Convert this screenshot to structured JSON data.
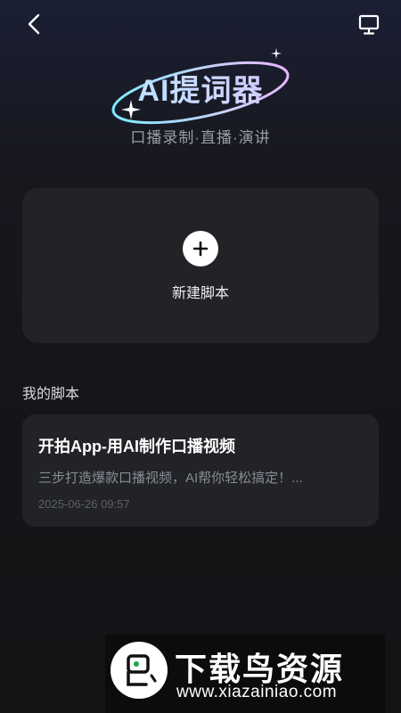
{
  "header": {
    "back_icon": "chevron-left-icon",
    "screen_icon": "monitor-icon"
  },
  "brand": {
    "title": "AI提词器",
    "subtitle": "口播录制·直播·演讲"
  },
  "new_script": {
    "icon": "plus-icon",
    "label": "新建脚本"
  },
  "my_scripts": {
    "section_title": "我的脚本",
    "items": [
      {
        "title": "开拍App-用AI制作口播视频",
        "description": "三步打造爆款口播视频，AI帮你轻松搞定！...",
        "date": "2025-06-26 09:57"
      }
    ]
  },
  "watermark": {
    "name": "下载鸟资源",
    "url": "www.xiazainiao.com"
  },
  "colors": {
    "background": "#141518",
    "card": "#222327",
    "title_gradient_start": "#9ef3ff",
    "title_gradient_end": "#e9b8ff"
  }
}
